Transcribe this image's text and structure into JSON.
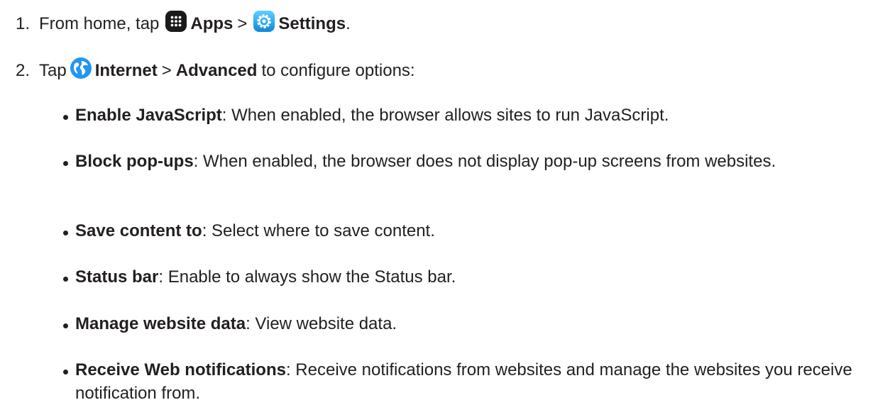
{
  "steps": [
    {
      "number": "1.",
      "text_before": "From home, tap",
      "apps_label": "Apps",
      "separator": ">",
      "settings_label": "Settings",
      "end": "."
    },
    {
      "number": "2.",
      "text_before": "Tap",
      "internet_label": "Internet",
      "separator": ">",
      "advanced_label": "Advanced",
      "text_after": "to configure options:"
    }
  ],
  "options": [
    {
      "term": "Enable JavaScript",
      "desc": ": When enabled, the browser allows sites to run JavaScript."
    },
    {
      "term": "Block pop-ups",
      "desc": ": When enabled, the browser does not display pop-up screens from websites."
    },
    {
      "term": "Save content to",
      "desc": ": Select where to save content."
    },
    {
      "term": "Status bar",
      "desc": ": Enable to always show the Status bar."
    },
    {
      "term": "Manage website data",
      "desc": ": View website data."
    },
    {
      "term": "Receive Web notifications",
      "desc": ": Receive notifications from websites and manage the websites you receive notification from."
    }
  ],
  "icons": {
    "apps": "apps-grid-icon",
    "settings": "settings-gear-icon",
    "internet": "internet-globe-icon"
  },
  "colors": {
    "text": "#231f20",
    "apps_icon": "#1a1a1a",
    "settings_icon": "#1aa3e8",
    "internet_icon": "#2196f3"
  }
}
